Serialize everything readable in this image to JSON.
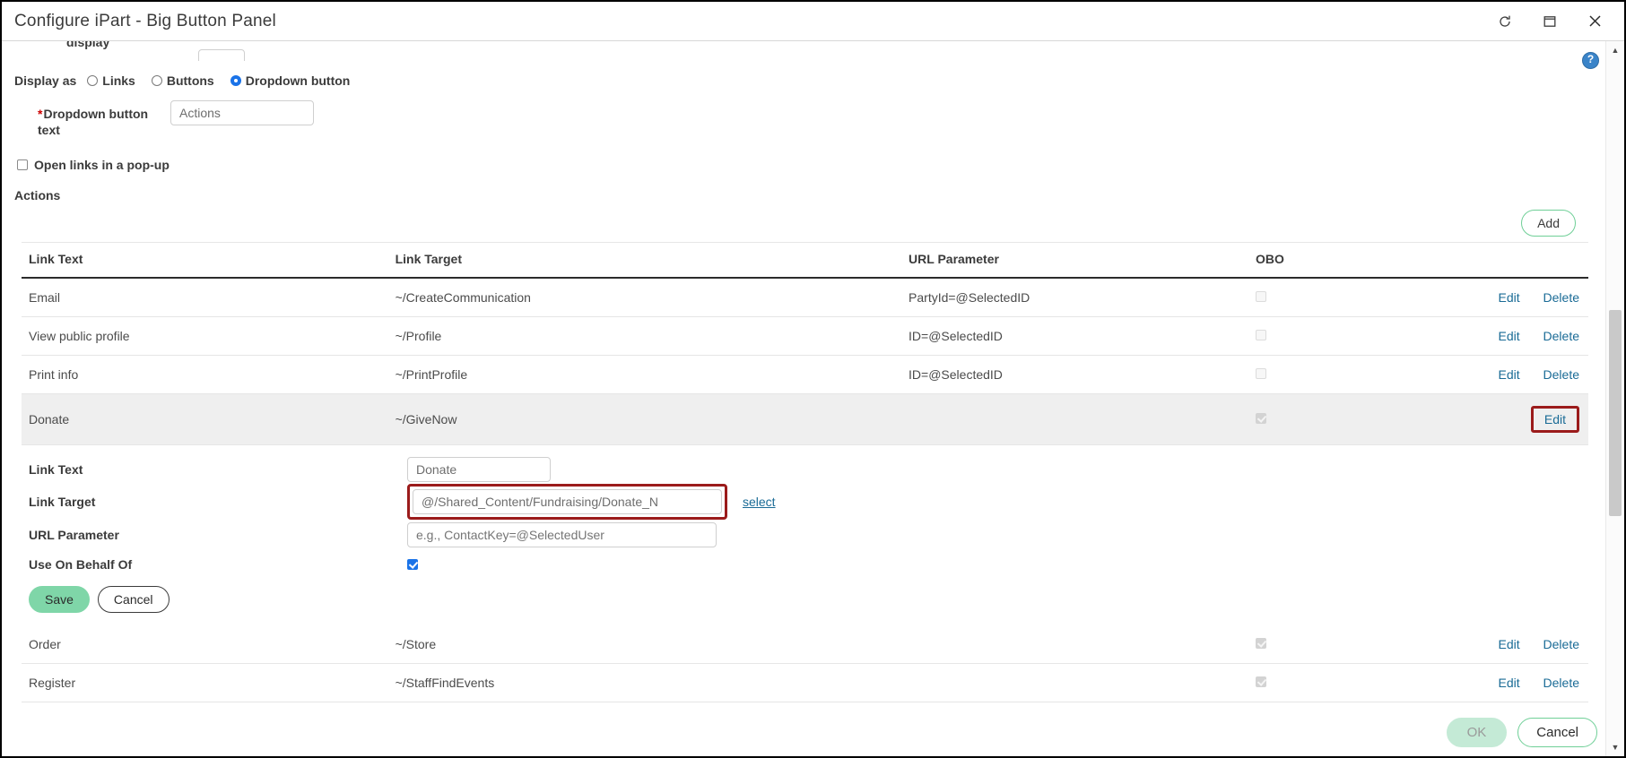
{
  "window": {
    "title": "Configure iPart - Big Button Panel",
    "controls": [
      {
        "name": "refresh-icon",
        "glyph": "refresh"
      },
      {
        "name": "maximize-icon",
        "glyph": "maximize"
      },
      {
        "name": "close-icon",
        "glyph": "close"
      }
    ]
  },
  "help": {
    "label": "?"
  },
  "clipped": {
    "label": "display"
  },
  "display_as": {
    "label": "Display as",
    "options": [
      {
        "label": "Links",
        "selected": false
      },
      {
        "label": "Buttons",
        "selected": false
      },
      {
        "label": "Dropdown button",
        "selected": true
      }
    ]
  },
  "dropdown_button_text": {
    "required_marker": "*",
    "label": "Dropdown button text",
    "placeholder": "Actions",
    "value": ""
  },
  "open_in_popup": {
    "label": "Open links in a pop-up",
    "checked": false
  },
  "actions_section": {
    "title": "Actions",
    "add_label": "Add"
  },
  "table": {
    "columns": [
      "Link Text",
      "Link Target",
      "URL Parameter",
      "OBO"
    ],
    "row_actions": {
      "edit": "Edit",
      "delete": "Delete"
    },
    "rows": [
      {
        "link_text": "Email",
        "link_target": "~/CreateCommunication",
        "url_parameter": "PartyId=@SelectedID",
        "obo_checked": false,
        "obo_disabled": false,
        "selected": false,
        "has_delete": true,
        "edit_highlighted": false
      },
      {
        "link_text": "View public profile",
        "link_target": "~/Profile",
        "url_parameter": "ID=@SelectedID",
        "obo_checked": false,
        "obo_disabled": false,
        "selected": false,
        "has_delete": true,
        "edit_highlighted": false
      },
      {
        "link_text": "Print info",
        "link_target": "~/PrintProfile",
        "url_parameter": "ID=@SelectedID",
        "obo_checked": false,
        "obo_disabled": false,
        "selected": false,
        "has_delete": true,
        "edit_highlighted": false
      },
      {
        "link_text": "Donate",
        "link_target": "~/GiveNow",
        "url_parameter": "",
        "obo_checked": true,
        "obo_disabled": true,
        "selected": true,
        "has_delete": false,
        "edit_highlighted": true
      }
    ],
    "rows_after_form": [
      {
        "link_text": "Order",
        "link_target": "~/Store",
        "url_parameter": "",
        "obo_checked": true,
        "obo_disabled": true,
        "selected": false,
        "has_delete": true,
        "edit_highlighted": false
      },
      {
        "link_text": "Register",
        "link_target": "~/StaffFindEvents",
        "url_parameter": "",
        "obo_checked": true,
        "obo_disabled": true,
        "selected": false,
        "has_delete": true,
        "edit_highlighted": false
      }
    ]
  },
  "edit_form": {
    "link_text": {
      "label": "Link Text",
      "value": "Donate",
      "placeholder": ""
    },
    "link_target": {
      "label": "Link Target",
      "value": "@/Shared_Content/Fundraising/Donate_N",
      "select_link": "select",
      "highlighted": true
    },
    "url_parameter": {
      "label": "URL Parameter",
      "value": "",
      "placeholder": "e.g., ContactKey=@SelectedUser"
    },
    "use_on_behalf_of": {
      "label": "Use On Behalf Of",
      "checked": true
    },
    "save_label": "Save",
    "cancel_label": "Cancel"
  },
  "footer": {
    "ok_label": "OK",
    "ok_disabled": true,
    "cancel_label": "Cancel"
  },
  "colors": {
    "accent_green": "#6fcf97",
    "save_green": "#7fd6a8",
    "ok_disabled_green": "#c4ead6",
    "link_blue": "#1a6b96",
    "radio_blue": "#1a73e8",
    "highlight_red": "#9b1b1b",
    "required_red": "#cc0000",
    "selected_row": "#efefef"
  }
}
